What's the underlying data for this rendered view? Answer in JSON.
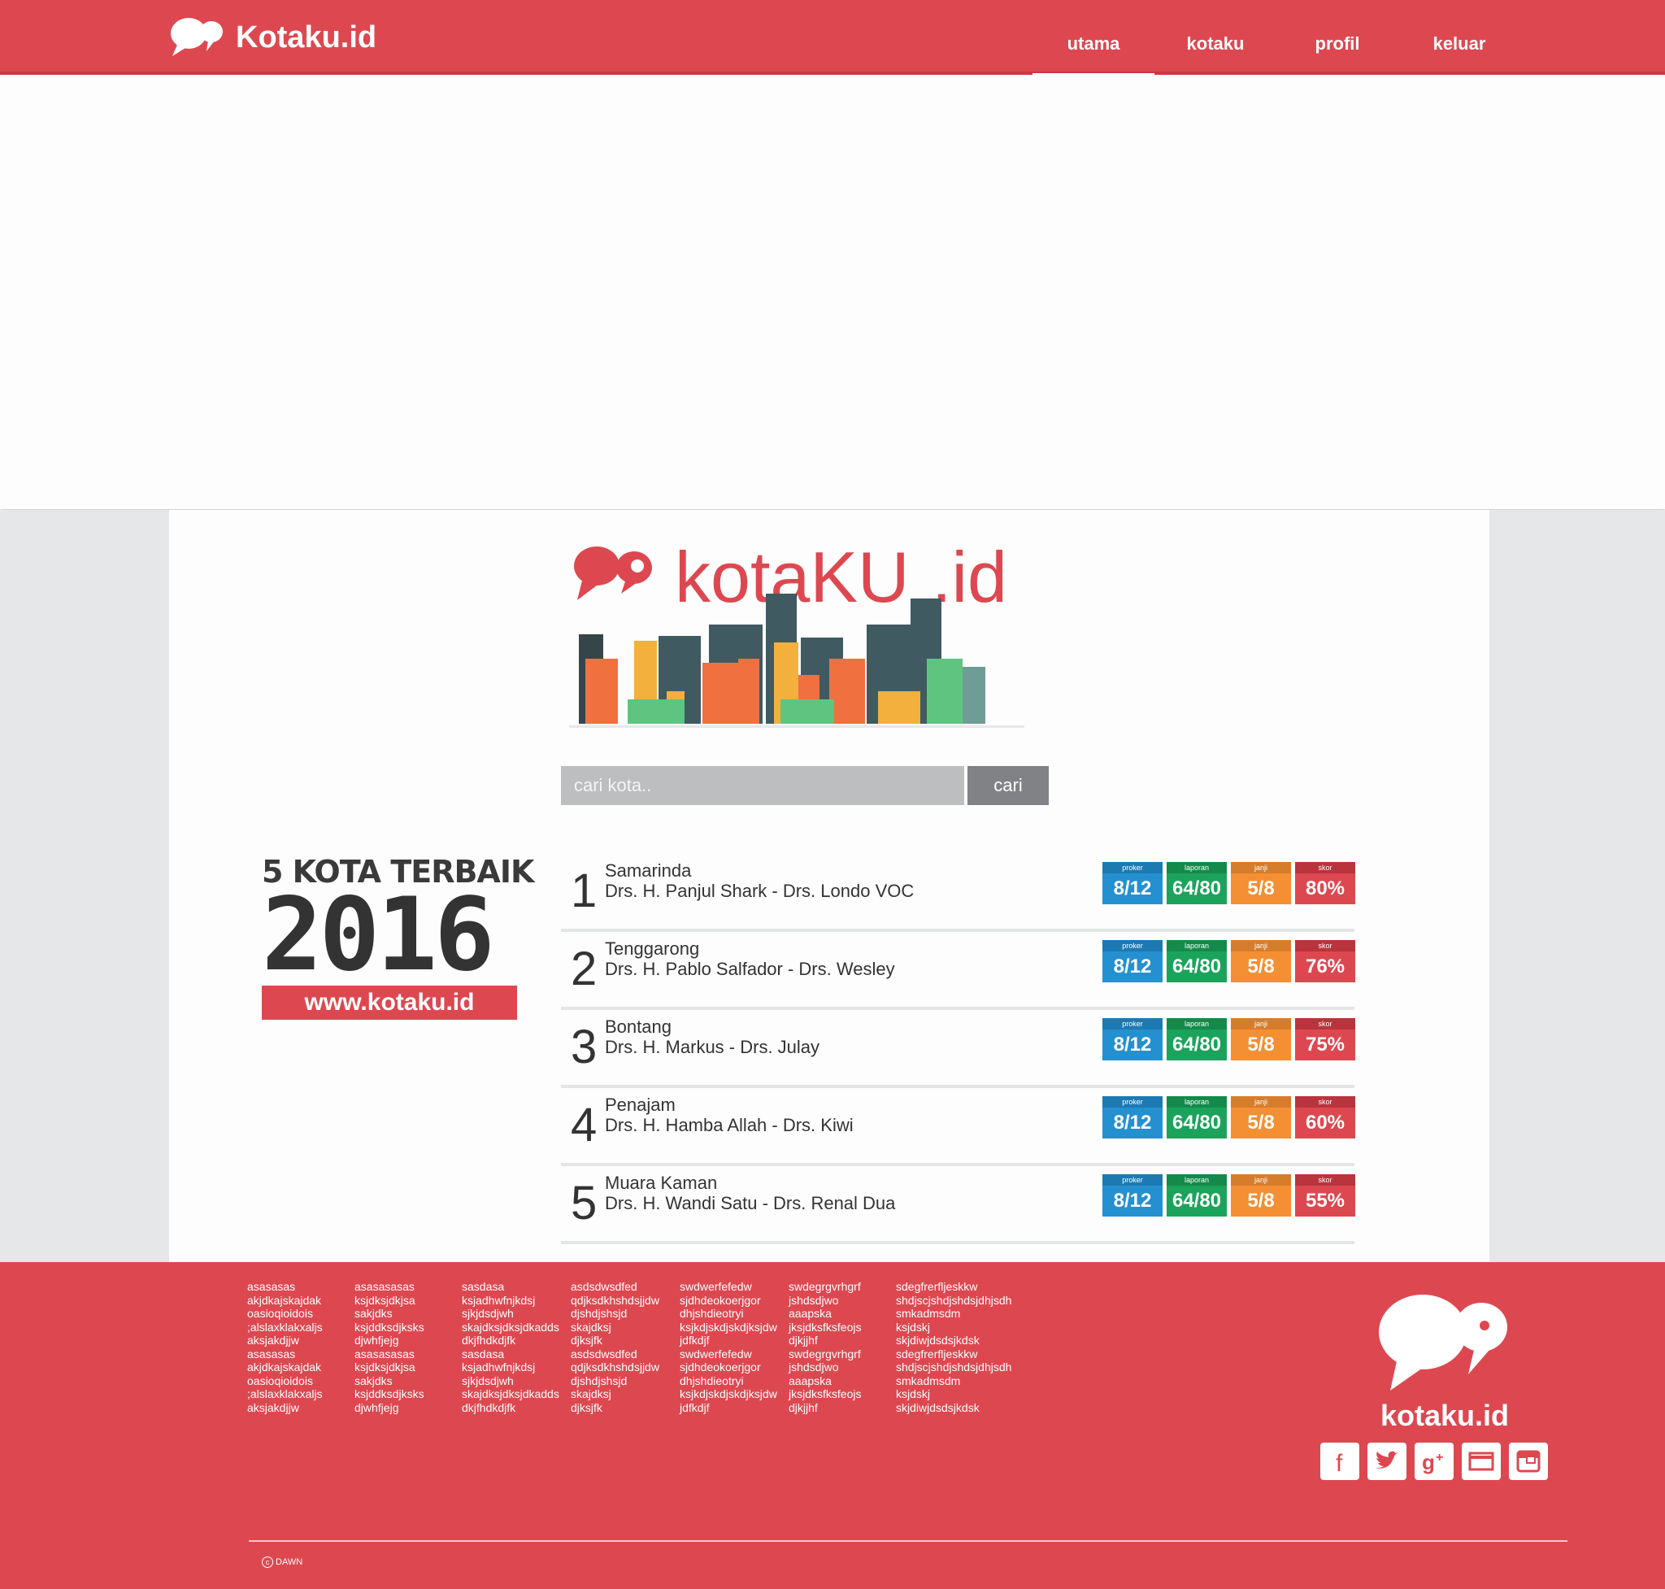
{
  "header": {
    "brand": "Kotaku.id",
    "nav": [
      {
        "label": "utama",
        "active": true
      },
      {
        "label": "kotaku",
        "active": false
      },
      {
        "label": "profil",
        "active": false
      },
      {
        "label": "keluar",
        "active": false
      }
    ]
  },
  "hero_logo": {
    "text_main": "kotaKU",
    "text_dot_id": ".id"
  },
  "search": {
    "placeholder": "cari kota..",
    "button": "cari"
  },
  "promo": {
    "line1": "5 KOTA TERBAIK",
    "year": "2016",
    "url": "www.kotaku.id"
  },
  "stat_labels": {
    "proker": "proker",
    "laporan": "laporan",
    "janji": "janji",
    "skor": "skor"
  },
  "ranking": [
    {
      "rank": "1",
      "city": "Samarinda",
      "leaders": "Drs. H. Panjul Shark - Drs. Londo VOC",
      "proker": "8/12",
      "laporan": "64/80",
      "janji": "5/8",
      "skor": "80%"
    },
    {
      "rank": "2",
      "city": "Tenggarong",
      "leaders": "Drs. H. Pablo Salfador - Drs. Wesley",
      "proker": "8/12",
      "laporan": "64/80",
      "janji": "5/8",
      "skor": "76%"
    },
    {
      "rank": "3",
      "city": "Bontang",
      "leaders": "Drs. H. Markus - Drs. Julay",
      "proker": "8/12",
      "laporan": "64/80",
      "janji": "5/8",
      "skor": "75%"
    },
    {
      "rank": "4",
      "city": "Penajam",
      "leaders": "Drs. H. Hamba Allah - Drs. Kiwi",
      "proker": "8/12",
      "laporan": "64/80",
      "janji": "5/8",
      "skor": "60%"
    },
    {
      "rank": "5",
      "city": "Muara Kaman",
      "leaders": "Drs. H. Wandi Satu - Drs. Renal Dua",
      "proker": "8/12",
      "laporan": "64/80",
      "janji": "5/8",
      "skor": "55%"
    }
  ],
  "footer": {
    "columns": [
      [
        "asasasas",
        "akjdkajskajdak",
        "oasioqioidois",
        ";alslaxklakxaljs",
        "aksjakdjjw",
        "asasasas",
        "akjdkajskajdak",
        "oasioqioidois",
        ";alslaxklakxaljs",
        "aksjakdjjw"
      ],
      [
        "asasasasas",
        "ksjdksjdkjsa",
        "sakjdks",
        "ksjddksdjksks",
        "djwhfjejg",
        "asasasasas",
        "ksjdksjdkjsa",
        "sakjdks",
        "ksjddksdjksks",
        "djwhfjejg"
      ],
      [
        "sasdasa",
        "ksjadhwfnjkdsj",
        "sjkjdsdjwh",
        "skajdksjdksjdkadds",
        "dkjfhdkdjfk",
        "sasdasa",
        "ksjadhwfnjkdsj",
        "sjkjdsdjwh",
        "skajdksjdksjdkadds",
        "dkjfhdkdjfk"
      ],
      [
        "asdsdwsdfed",
        "qdjksdkhshdsjjdw",
        "djshdjshsjd",
        "skajdksj",
        "djksjfk",
        "asdsdwsdfed",
        "qdjksdkhshdsjjdw",
        "djshdjshsjd",
        "skajdksj",
        "djksjfk"
      ],
      [
        "swdwerfefedw",
        "sjdhdeokoerjgor",
        "dhjshdieotryi",
        "ksjkdjskdjskdjksjdw",
        "jdfkdjf",
        "swdwerfefedw",
        "sjdhdeokoerjgor",
        "dhjshdieotryi",
        "ksjkdjskdjskdjksjdw",
        "jdfkdjf"
      ],
      [
        "swdegrgvrhgrf",
        "jshdsdjwo",
        "aaapska",
        "jksjdksfksfeojs",
        "djkjjhf",
        "swdegrgvrhgrf",
        "jshdsdjwo",
        "aaapska",
        "jksjdksfksfeojs",
        "djkjjhf"
      ],
      [
        "sdegfrerfljeskkw",
        "shdjscjshdjshdsjdhjsdh",
        "smkadmsdm",
        "ksjdskj",
        "skjdiwjdsdsjkdsk",
        "sdegfrerfljeskkw",
        "shdjscjshdjshdsjdhjsdh",
        "smkadmsdm",
        "ksjdskj",
        "skjdiwjdsdsjkdsk"
      ]
    ],
    "brand": "kotaku.id",
    "social": [
      "facebook-icon",
      "twitter-icon",
      "google-plus-icon",
      "email-icon",
      "instagram-icon"
    ],
    "copyright_symbol": "c",
    "copyright": "DAWN"
  },
  "colors": {
    "brand_red": "#dd4850",
    "proker_blue": "#2590cf",
    "laporan_green": "#1ba35b",
    "janji_orange": "#f48f33",
    "skor_red": "#dd4850"
  }
}
